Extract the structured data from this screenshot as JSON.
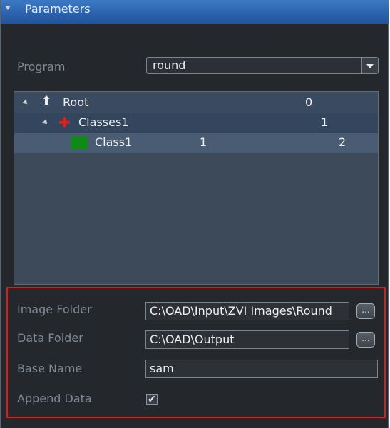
{
  "panel": {
    "title": "Parameters"
  },
  "program": {
    "label": "Program",
    "selected": "round"
  },
  "tree": {
    "rows": [
      {
        "label": "Root",
        "col1": "",
        "col2": "0"
      },
      {
        "label": "Classes1",
        "col1": "",
        "col2": "1"
      },
      {
        "label": "Class1",
        "col1": "1",
        "col2": "2"
      }
    ]
  },
  "fields": {
    "image_folder": {
      "label": "Image Folder",
      "value": "C:\\OAD\\Input\\ZVI Images\\Round",
      "browse": "..."
    },
    "data_folder": {
      "label": "Data Folder",
      "value": "C:\\OAD\\Output",
      "browse": "..."
    },
    "base_name": {
      "label": "Base Name",
      "value": "sam"
    },
    "append_data": {
      "label": "Append Data",
      "checked": true,
      "check_glyph": "✔"
    }
  },
  "colors": {
    "header_blue": "#2c63ad",
    "panel_bg": "#24272b",
    "tree_bg": "#3d4a5a",
    "class_swatch": "#0f8a16",
    "cross_red": "#e0211b",
    "highlight_border": "#d81d1d"
  },
  "icons": {
    "collapse": "collapse-arrow-icon",
    "expander": "expander-triangle-icon",
    "root": "up-arrow-icon",
    "classes": "red-cross-icon",
    "class": "green-swatch-icon",
    "checkbox": "checkmark-icon"
  }
}
